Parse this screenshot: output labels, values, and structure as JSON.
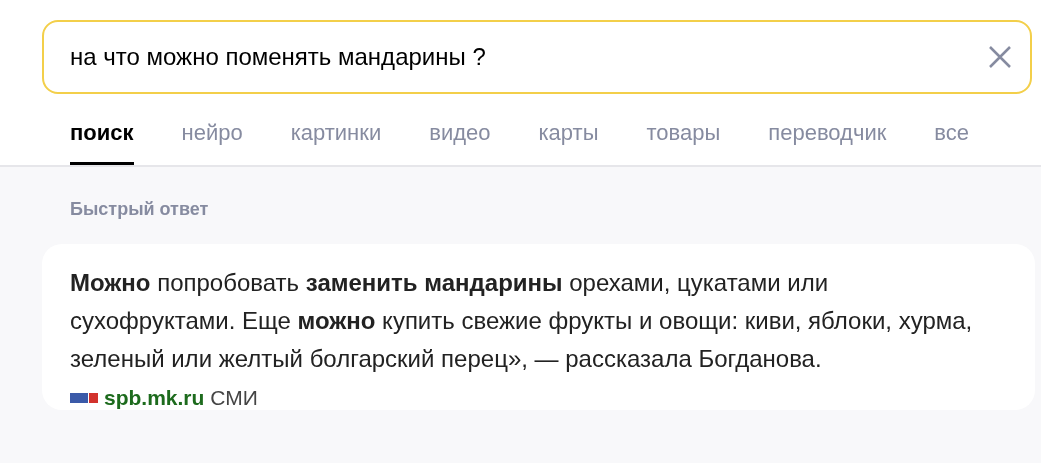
{
  "search": {
    "value": "на что можно поменять мандарины ?"
  },
  "tabs": [
    {
      "label": "поиск",
      "selected": true
    },
    {
      "label": "нейро",
      "selected": false
    },
    {
      "label": "картинки",
      "selected": false
    },
    {
      "label": "видео",
      "selected": false
    },
    {
      "label": "карты",
      "selected": false
    },
    {
      "label": "товары",
      "selected": false
    },
    {
      "label": "переводчик",
      "selected": false
    },
    {
      "label": "все",
      "selected": false
    }
  ],
  "quick_answer": {
    "heading": "Быстрый ответ",
    "text": "**Можно** попробовать **заменить мандарины** орехами, цукатами или сухофруктами. Еще **можно** купить свежие фрукты и овощи: киви, яблоки, хурма, зеленый или желтый болгарский перец», — рассказала Богданова.",
    "source": {
      "site": "spb.mk.ru",
      "category": "СМИ"
    }
  }
}
